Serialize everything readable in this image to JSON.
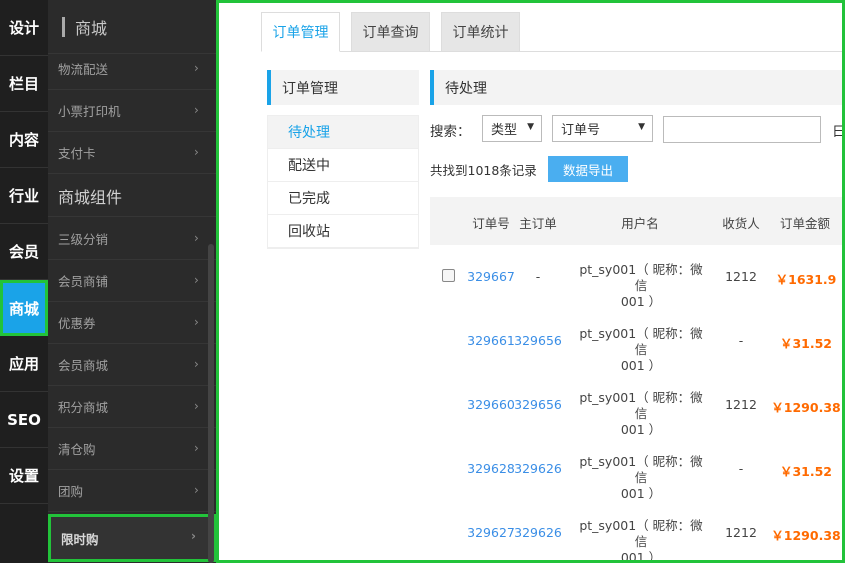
{
  "main_nav": [
    {
      "label": "设计",
      "active": false
    },
    {
      "label": "栏目",
      "active": false
    },
    {
      "label": "内容",
      "active": false
    },
    {
      "label": "行业",
      "active": false
    },
    {
      "label": "会员",
      "active": false
    },
    {
      "label": "商城",
      "active": true
    },
    {
      "label": "应用",
      "active": false
    },
    {
      "label": "SEO",
      "active": false
    },
    {
      "label": "设置",
      "active": false
    }
  ],
  "sub_nav": {
    "title": "商城",
    "items_top": [
      "物流配送",
      "小票打印机",
      "支付卡"
    ],
    "group_title": "商城组件",
    "items_bottom": [
      "三级分销",
      "会员商铺",
      "优惠券",
      "会员商城",
      "积分商城",
      "清仓购",
      "团购",
      "限时购"
    ],
    "highlighted_item": "限时购"
  },
  "tabs": [
    {
      "label": "订单管理",
      "active": true
    },
    {
      "label": "订单查询",
      "active": false
    },
    {
      "label": "订单统计",
      "active": false
    }
  ],
  "left_panel": {
    "title": "订单管理",
    "items": [
      {
        "label": "待处理",
        "active": true
      },
      {
        "label": "配送中",
        "active": false
      },
      {
        "label": "已完成",
        "active": false
      },
      {
        "label": "回收站",
        "active": false
      }
    ]
  },
  "right_panel": {
    "title": "待处理",
    "search_label": "搜索：",
    "type_select": "类型",
    "field_select": "订单号",
    "search_value": "",
    "date_label": "日",
    "count_text": "共找到1018条记录",
    "export_button": "数据导出"
  },
  "table": {
    "headers": [
      "订单号",
      "主订单",
      "用户名",
      "收货人",
      "订单金额"
    ],
    "rows": [
      {
        "has_checkbox": true,
        "order_no": "329667",
        "main_order": "-",
        "user_line1": "pt_sy001（ 昵称：微信",
        "user_line2": "001 ）",
        "receiver": "1212",
        "amount": "￥1631.9"
      },
      {
        "has_checkbox": false,
        "order_no": "329661",
        "main_order": "329656",
        "user_line1": "pt_sy001（ 昵称：微信",
        "user_line2": "001 ）",
        "receiver": "-",
        "amount": "￥31.52"
      },
      {
        "has_checkbox": false,
        "order_no": "329660",
        "main_order": "329656",
        "user_line1": "pt_sy001（ 昵称：微信",
        "user_line2": "001 ）",
        "receiver": "1212",
        "amount": "￥1290.38"
      },
      {
        "has_checkbox": false,
        "order_no": "329628",
        "main_order": "329626",
        "user_line1": "pt_sy001（ 昵称：微信",
        "user_line2": "001 ）",
        "receiver": "-",
        "amount": "￥31.52"
      },
      {
        "has_checkbox": false,
        "order_no": "329627",
        "main_order": "329626",
        "user_line1": "pt_sy001（ 昵称：微信",
        "user_line2": "001 ）",
        "receiver": "1212",
        "amount": "￥1290.38"
      }
    ]
  },
  "colors": {
    "accent": "#1aa3e8",
    "highlight_border": "#22c33a",
    "amount": "#ff6a00",
    "link": "#3a8ee6"
  }
}
